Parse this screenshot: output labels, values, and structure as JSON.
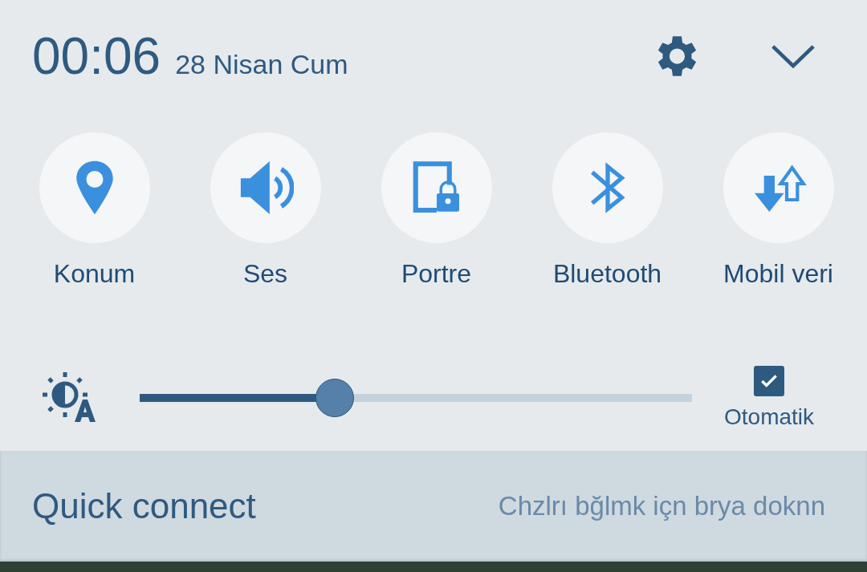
{
  "header": {
    "time": "00:06",
    "date": "28 Nisan Cum"
  },
  "tiles": [
    {
      "kind": "location",
      "label": "Konum"
    },
    {
      "kind": "sound",
      "label": "Ses"
    },
    {
      "kind": "rotation-lock",
      "label": "Portre"
    },
    {
      "kind": "bluetooth",
      "label": "Bluetooth"
    },
    {
      "kind": "mobile-data",
      "label": "Mobil veri"
    }
  ],
  "brightness": {
    "level": 0.353,
    "auto_checked": true,
    "auto_label": "Otomatik"
  },
  "quick_connect": {
    "title": "Quick connect",
    "hint": "Chzlrı bğlmk içn brya doknn"
  }
}
